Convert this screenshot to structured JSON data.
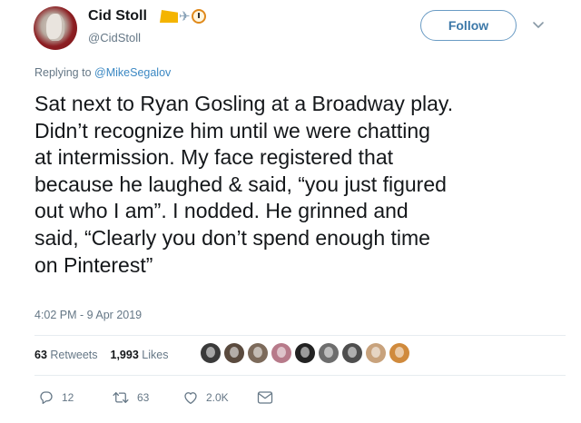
{
  "header": {
    "display_name": "Cid Stoll",
    "handle": "@CidStoll",
    "name_emoji": [
      "cheese-icon",
      "airplane-icon",
      "clock-icon"
    ],
    "follow_label": "Follow"
  },
  "reply": {
    "prefix": "Replying to",
    "mention": "@MikeSegalov"
  },
  "tweet": {
    "lines": [
      "Sat next to Ryan Gosling at a Broadway play.",
      "Didn’t recognize him until we were chatting",
      "at intermission. My face registered that",
      "because he laughed & said, “you just figured",
      "out who I am”. I nodded. He grinned and",
      "said, “Clearly you don’t spend enough time",
      "on Pinterest”"
    ],
    "timestamp": "4:02 PM - 9 Apr 2019"
  },
  "stats": {
    "retweets_count": "63",
    "retweets_label": "Retweets",
    "likes_count": "1,993",
    "likes_label": "Likes"
  },
  "likers": {
    "avatar_colors": [
      "#3a3a3a",
      "#5a4a3e",
      "#7c6a5a",
      "#b77a8a",
      "#222222",
      "#6d6d6d",
      "#4e4e4e",
      "#c8a27c",
      "#d08a3c"
    ]
  },
  "actions": {
    "replies": "12",
    "retweets": "63",
    "likes": "2.0K",
    "icons": [
      "reply-icon",
      "retweet-icon",
      "heart-icon",
      "message-icon"
    ]
  },
  "colors": {
    "text": "#14171a",
    "secondary": "#657786",
    "link": "#3b88c3",
    "follow_border": "#6a9bc4",
    "divider": "#e6ecf0"
  }
}
